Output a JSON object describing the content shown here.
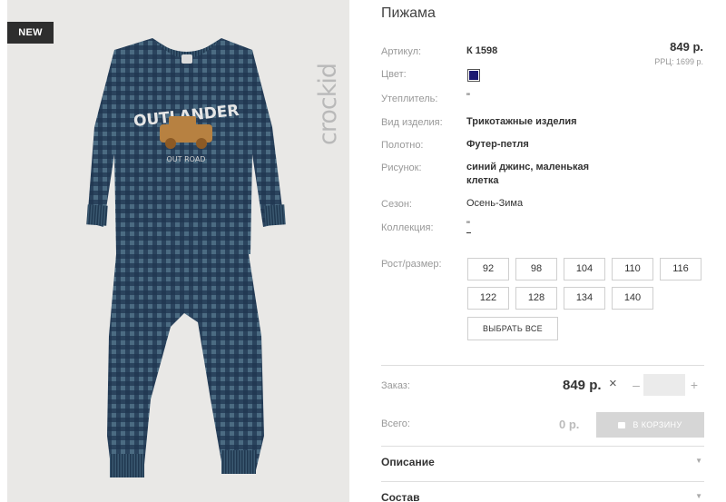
{
  "image": {
    "badge": "NEW",
    "brand": "crockid",
    "print_title": "OUTLANDER",
    "print_subtitle": "OUT ROAD"
  },
  "product": {
    "title": "Пижама",
    "price": "849 р.",
    "rrp": "РРЦ: 1699 р."
  },
  "attributes": {
    "article_label": "Артикул:",
    "article_value": "К 1598",
    "color_label": "Цвет:",
    "color_swatch": "#1d1a72",
    "insulation_label": "Утеплитель:",
    "insulation_value": "\"",
    "type_label": "Вид изделия:",
    "type_value": "Трикотажные изделия",
    "fabric_label": "Полотно:",
    "fabric_value": "Футер-петля",
    "pattern_label": "Рисунок:",
    "pattern_value_line1": "синий джинс, маленькая",
    "pattern_value_line2": "клетка",
    "season_label": "Сезон:",
    "season_value": "Осень-Зима",
    "collection_label": "Коллекция:",
    "collection_value": "\""
  },
  "sizes": {
    "label": "Рост/размер:",
    "items": [
      "92",
      "98",
      "104",
      "110",
      "116",
      "122",
      "128",
      "134",
      "140"
    ],
    "select_all": "ВЫБРАТЬ ВСЕ"
  },
  "order": {
    "label": "Заказ:",
    "price": "849 р.",
    "times": "×",
    "minus": "–",
    "plus": "+",
    "quantity": ""
  },
  "total": {
    "label": "Всего:",
    "value": "0 р.",
    "cart_button": "В КОРЗИНУ"
  },
  "sections": {
    "description": "Описание",
    "composition": "Состав"
  },
  "colors": {
    "accent_swatch": "#1d1a72",
    "fabric_dark": "#1f3550",
    "fabric_light": "#4e6e85",
    "badge_bg": "#2e2e2e",
    "print_car": "#b78141"
  }
}
